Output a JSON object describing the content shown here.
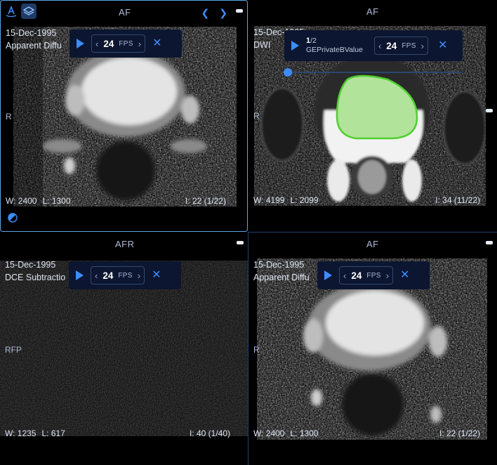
{
  "colors": {
    "accent": "#3d8dff",
    "active_border": "#5aa6e6",
    "segmentation": "#7ed36a"
  },
  "viewports": [
    {
      "orientation_top": "AF",
      "orientation_left": "R",
      "date": "15-Dec-1995",
      "series": "Apparent Diffu",
      "wl": {
        "w": "W: 2400",
        "l": "L: 1300"
      },
      "image_index": "I: 22 (1/22)",
      "fps": "24",
      "fps_unit": "FPS",
      "active": true,
      "icons": [
        "orientation-marker-icon",
        "layers-icon",
        "window-level-icon"
      ]
    },
    {
      "orientation_top": "AF",
      "orientation_left": "R",
      "date": "15-Dec-1995",
      "series": "DWI",
      "wl": {
        "w": "W: 4199",
        "l": "L: 2099"
      },
      "image_index": "I: 34 (11/22)",
      "fps": "24",
      "fps_unit": "FPS",
      "bvalue": {
        "current": "1",
        "total": "/2",
        "label": "GEPrivateBValue",
        "position": 0.0
      }
    },
    {
      "orientation_top": "AFR",
      "orientation_left": "RFP",
      "date": "15-Dec-1995",
      "series": "DCE Subtractio",
      "wl": {
        "w": "W: 1235",
        "l": "L: 617"
      },
      "image_index": "I: 40 (1/40)",
      "fps": "24",
      "fps_unit": "FPS"
    },
    {
      "orientation_top": "AF",
      "orientation_left": "R",
      "date": "15-Dec-1995",
      "series": "Apparent Diffu",
      "wl": {
        "w": "W: 2400",
        "l": "L: 1300"
      },
      "image_index": "I: 22 (1/22)",
      "fps": "24",
      "fps_unit": "FPS"
    }
  ],
  "glyphs": {
    "play": "▶",
    "prev": "‹",
    "next": "›",
    "close": "✕",
    "nav_prev": "❮",
    "nav_next": "❯"
  }
}
